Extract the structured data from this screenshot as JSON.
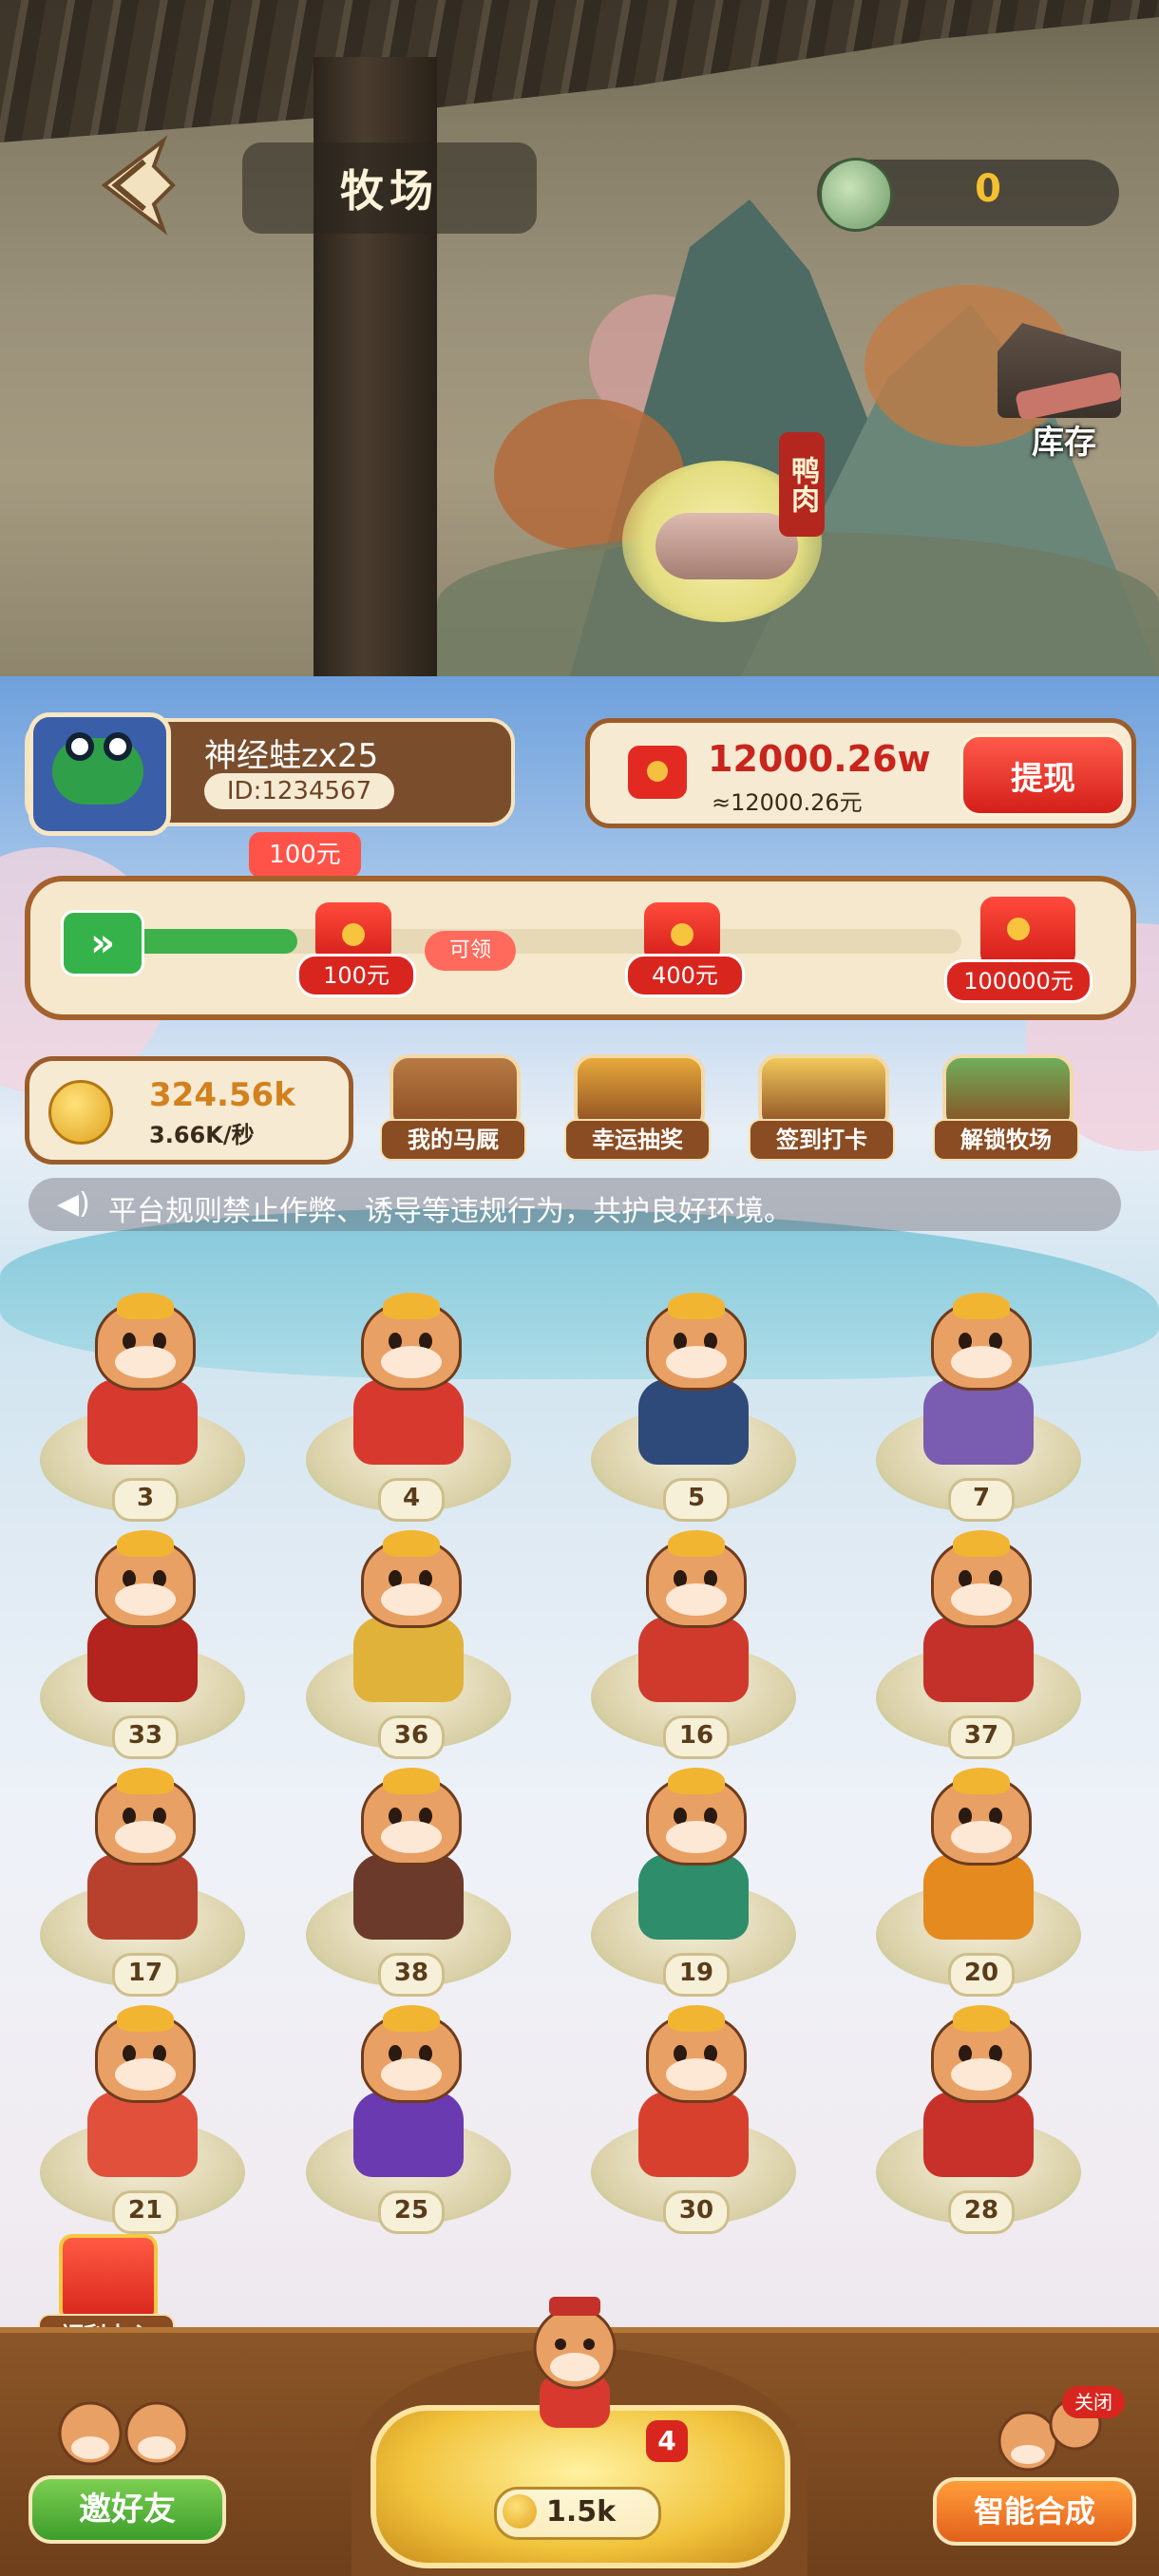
{
  "header": {
    "title": "牧场",
    "resource_value": "0",
    "storage_label": "库存",
    "duck_tag": "鸭肉"
  },
  "user": {
    "name": "神经蛙zx25",
    "id": "ID:1234567"
  },
  "cash": {
    "value": "12000.26w",
    "approx": "≈12000.26元",
    "withdraw_label": "提现"
  },
  "progress": {
    "tooltip": "100元",
    "claimable_label": "可领",
    "fill_fraction": 0.24,
    "milestones": [
      {
        "label": "100元"
      },
      {
        "label": "400元"
      },
      {
        "label": "100000元"
      }
    ]
  },
  "gold": {
    "value": "324.56k",
    "rate": "3.66K/秒"
  },
  "functions": [
    {
      "label": "我的马厩",
      "icon": "stable-icon",
      "color": "#b77a44"
    },
    {
      "label": "幸运抽奖",
      "icon": "wheel-icon",
      "color": "#e7a83a"
    },
    {
      "label": "签到打卡",
      "icon": "calendar-icon",
      "color": "#f0c85a"
    },
    {
      "label": "解锁牧场",
      "icon": "ranch-icon",
      "color": "#6fae5a"
    }
  ],
  "notice": "平台规则禁止作弊、诱导等违规行为，共护良好环境。",
  "grid": [
    {
      "level": "3",
      "color": "#d8392e"
    },
    {
      "level": "4",
      "color": "#d8392e"
    },
    {
      "level": "5",
      "color": "#2e4a7a"
    },
    {
      "level": "7",
      "color": "#7a5cb0"
    },
    {
      "level": "33",
      "color": "#b2241d"
    },
    {
      "level": "36",
      "color": "#e0b23a"
    },
    {
      "level": "16",
      "color": "#cf3a2c"
    },
    {
      "level": "37",
      "color": "#c4312a"
    },
    {
      "level": "17",
      "color": "#b8412e"
    },
    {
      "level": "38",
      "color": "#6b3a2a"
    },
    {
      "level": "19",
      "color": "#2e8d6a"
    },
    {
      "level": "20",
      "color": "#e58a1f"
    },
    {
      "level": "21",
      "color": "#e0503a"
    },
    {
      "level": "25",
      "color": "#6a3ab0"
    },
    {
      "level": "30",
      "color": "#d8402e"
    },
    {
      "level": "28",
      "color": "#c8302a"
    }
  ],
  "welfare_label": "福利中心",
  "bottom": {
    "invite_label": "邀好友",
    "buy_level": "4",
    "buy_cost": "1.5k",
    "merge_label": "智能合成",
    "merge_close": "关闭"
  }
}
